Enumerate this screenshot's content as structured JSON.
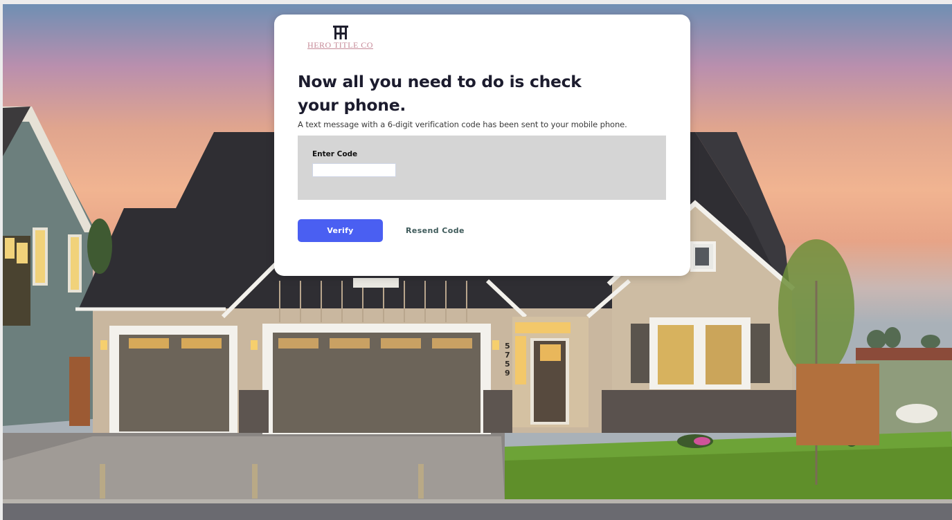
{
  "brand": {
    "logo_monogram": "HT",
    "logo_text": "HERO TITLE CO",
    "logo_color": "#c68a98"
  },
  "verification": {
    "title": "Now all you need to do is check your phone.",
    "subtitle": "A text message with a 6-digit verification code has been sent to your mobile phone.",
    "code_label": "Enter Code",
    "code_value": "",
    "verify_label": "Verify",
    "resend_label": "Resend Code"
  },
  "scene": {
    "house_number": "5759"
  },
  "colors": {
    "accent": "#4a5ff2",
    "panel": "#d5d5d5",
    "resend": "#3e5a5a"
  }
}
